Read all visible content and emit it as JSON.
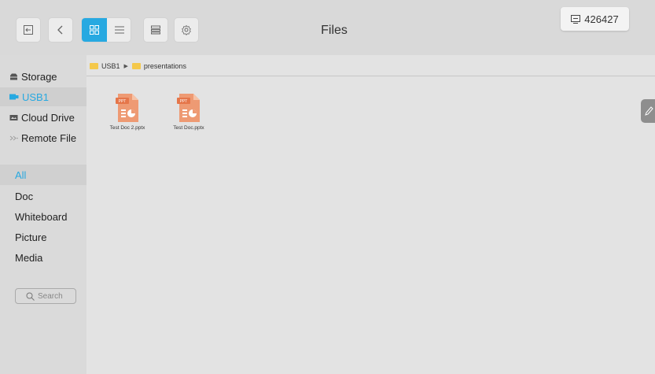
{
  "header": {
    "title": "Files",
    "code": "426427"
  },
  "toolbar": {
    "exit_icon": "exit-icon",
    "back_icon": "chevron-left-icon",
    "grid_icon": "grid-view-icon",
    "list_icon": "list-view-icon",
    "multiselect_icon": "multi-select-icon",
    "settings_icon": "gear-icon",
    "accent": "#27a9e1"
  },
  "sidebar": {
    "sources": [
      {
        "label": "Storage",
        "icon": "storage-icon"
      },
      {
        "label": "USB1",
        "icon": "usb-icon",
        "selected": true
      },
      {
        "label": "Cloud Drive",
        "icon": "cloud-drive-icon"
      },
      {
        "label": "Remote File",
        "icon": "remote-file-icon"
      }
    ],
    "categories": [
      {
        "label": "All",
        "selected": true
      },
      {
        "label": "Doc"
      },
      {
        "label": "Whiteboard"
      },
      {
        "label": "Picture"
      },
      {
        "label": "Media"
      }
    ],
    "search_placeholder": "Search"
  },
  "breadcrumb": {
    "items": [
      "USB1",
      "presentations"
    ]
  },
  "files": [
    {
      "name": "Test Doc 2.pptx",
      "type": "PPT"
    },
    {
      "name": "Test Doc.pptx",
      "type": "PPT"
    }
  ]
}
